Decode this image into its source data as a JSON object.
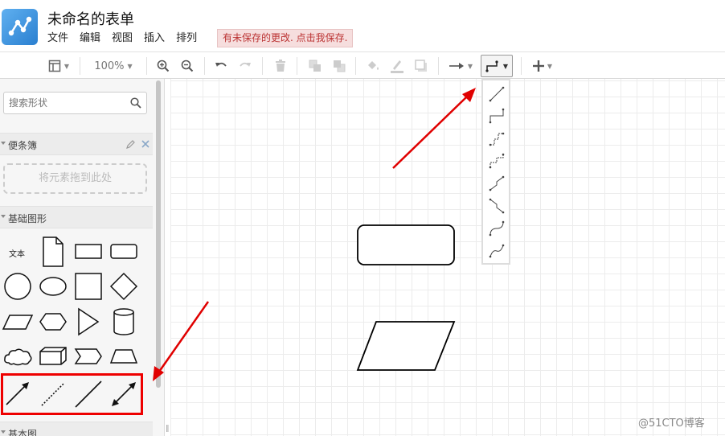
{
  "header": {
    "title": "未命名的表单",
    "menu": [
      "文件",
      "编辑",
      "视图",
      "插入",
      "排列"
    ],
    "unsaved_notice": "有未保存的更改. 点击我保存."
  },
  "toolbar": {
    "zoom_label": "100%",
    "icons": [
      "panel-layout-icon",
      "zoom-in-icon",
      "zoom-out-icon",
      "undo-icon",
      "redo-icon",
      "delete-icon",
      "to-front-icon",
      "to-back-icon",
      "fill-color-icon",
      "line-color-icon",
      "shadow-icon",
      "connection-arrow-icon",
      "waypoint-style-icon",
      "insert-plus-icon"
    ]
  },
  "sidebar": {
    "search_placeholder": "搜索形状",
    "scratchpad": {
      "title": "便条簿",
      "drop_hint": "将元素拖到此处"
    },
    "general": {
      "title": "基础图形",
      "text_shape_label": "文本",
      "shapes": [
        "text",
        "note",
        "rectangle",
        "rounded-rectangle",
        "ellipse",
        "ellipse-wide",
        "square",
        "diamond",
        "parallelogram",
        "hexagon",
        "triangle",
        "cylinder",
        "cloud",
        "cube",
        "step",
        "trapezoid",
        "arrow",
        "dotted-line",
        "line",
        "bidirectional-arrow"
      ]
    },
    "next_section": "基本图"
  },
  "canvas": {
    "shapes": [
      "rounded-rectangle",
      "parallelogram"
    ]
  },
  "edge_style_menu": {
    "options": [
      "straight",
      "orthogonal",
      "simple",
      "isometric",
      "horizontal-elbow",
      "vertical-elbow",
      "curved",
      "entity-relation"
    ]
  },
  "watermark": "@51CTO博客",
  "colors": {
    "accent_red": "#e00000",
    "notice_bg": "#f6dede",
    "notice_text": "#bb3333"
  }
}
